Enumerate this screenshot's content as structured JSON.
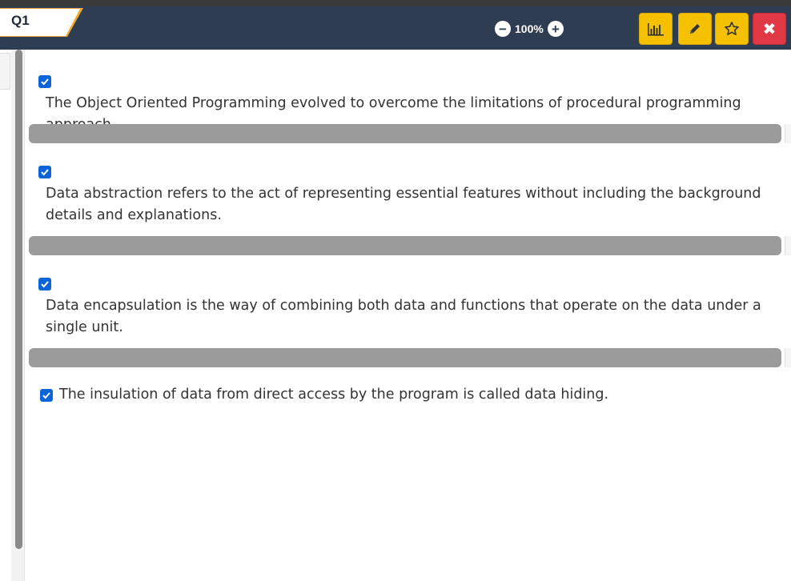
{
  "header": {
    "question_tab": "Q1",
    "zoom_level": "100%",
    "zoom_out_icon": "minus-circle-icon",
    "zoom_in_icon": "plus-circle-icon",
    "buttons": [
      {
        "name": "stats-button",
        "icon": "bar-chart-icon"
      },
      {
        "name": "edit-button",
        "icon": "pencil-icon"
      },
      {
        "name": "favorite-button",
        "icon": "star-icon"
      },
      {
        "name": "close-button",
        "icon": "close-icon",
        "label": "✖"
      }
    ],
    "colors": {
      "bar": "#2f3d52",
      "accent": "#f0a830",
      "yellow": "#f5c000",
      "red": "#e03844"
    }
  },
  "statements": [
    {
      "checked": true,
      "text": "The Object Oriented Programming evolved to overcome the limitations of procedural programming approach."
    },
    {
      "checked": true,
      "text": "Data abstraction refers to the act of representing essential features without including the background details and explanations."
    },
    {
      "checked": true,
      "text": "Data encapsulation is the way of combining both data and functions that operate on the data under a single unit."
    },
    {
      "checked": true,
      "text": "The insulation of data from direct access by the program is called data hiding."
    }
  ]
}
